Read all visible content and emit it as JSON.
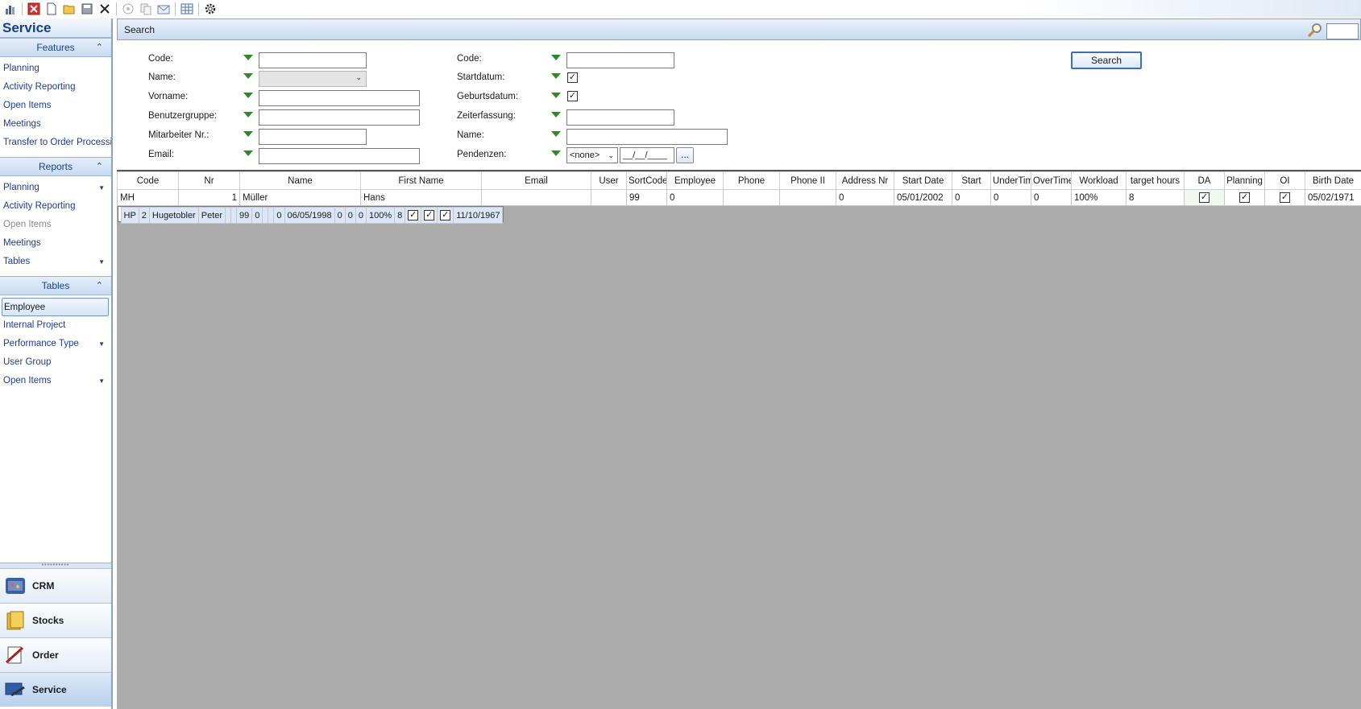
{
  "toolbar": {
    "icons": [
      "chart-icon",
      "delete-icon",
      "new-icon",
      "open-icon",
      "save-icon",
      "close-icon",
      "option-icon",
      "copy-icon",
      "mail-icon",
      "grid-icon",
      "settings-icon"
    ]
  },
  "sidebar": {
    "title": "Service",
    "groups": [
      {
        "header": "Features",
        "items": [
          {
            "label": "Planning"
          },
          {
            "label": "Activity Reporting"
          },
          {
            "label": "Open Items"
          },
          {
            "label": "Meetings"
          },
          {
            "label": "Transfer to Order Processing"
          }
        ]
      },
      {
        "header": "Reports",
        "items": [
          {
            "label": "Planning"
          },
          {
            "label": "Activity Reporting"
          },
          {
            "label": "Open Items"
          },
          {
            "label": "Meetings"
          },
          {
            "label": "Tables"
          }
        ]
      },
      {
        "header": "Tables",
        "items": [
          {
            "label": "Employee"
          },
          {
            "label": "Internal Project"
          },
          {
            "label": "Performance Type"
          },
          {
            "label": "User Group"
          },
          {
            "label": "Open Items"
          }
        ]
      }
    ],
    "modules": [
      {
        "label": "CRM"
      },
      {
        "label": "Stocks"
      },
      {
        "label": "Order"
      },
      {
        "label": "Service"
      }
    ]
  },
  "search": {
    "title": "Search",
    "button": "Search",
    "left_labels": [
      "Code:",
      "Name:",
      "Vorname:",
      "Benutzergruppe:",
      "Mitarbeiter Nr.:",
      "Email:"
    ],
    "right_labels": [
      "Code:",
      "Startdatum:",
      "Geburtsdatum:",
      "Zeiterfassung:",
      "Name:",
      "Pendenzen:"
    ],
    "pendenzen_option": "<none>",
    "pendenzen_date": "__/__/____",
    "ellipsis": "..."
  },
  "grid": {
    "columns": [
      "Code",
      "Nr",
      "Name",
      "First Name",
      "Email",
      "User",
      "SortCode",
      "Employee",
      "Phone",
      "Phone II",
      "Address Nr",
      "Start Date",
      "Start",
      "UnderTime",
      "OverTime",
      "Workload",
      "target hours",
      "DA",
      "Planning",
      "OI",
      "Birth Date"
    ],
    "rows": [
      {
        "code": "MH",
        "nr": "1",
        "name": "Müller",
        "first": "Hans",
        "email": "",
        "user": "",
        "sort": "99",
        "employee": "0",
        "phone": "",
        "phone2": "",
        "addr": "0",
        "start_date": "05/01/2002",
        "start": "0",
        "under": "0",
        "over": "0",
        "workload": "100%",
        "target": "8",
        "da": true,
        "planning": true,
        "oi": true,
        "birth": "05/02/1971"
      },
      {
        "code": "HP",
        "nr": "2",
        "name": "Hugetobler",
        "first": "Peter",
        "email": "",
        "user": "",
        "sort": "99",
        "employee": "0",
        "phone": "",
        "phone2": "",
        "addr": "0",
        "start_date": "06/05/1998",
        "start": "0",
        "under": "0",
        "over": "0",
        "workload": "100%",
        "target": "8",
        "da": true,
        "planning": true,
        "oi": true,
        "birth": "11/10/1967"
      }
    ]
  }
}
